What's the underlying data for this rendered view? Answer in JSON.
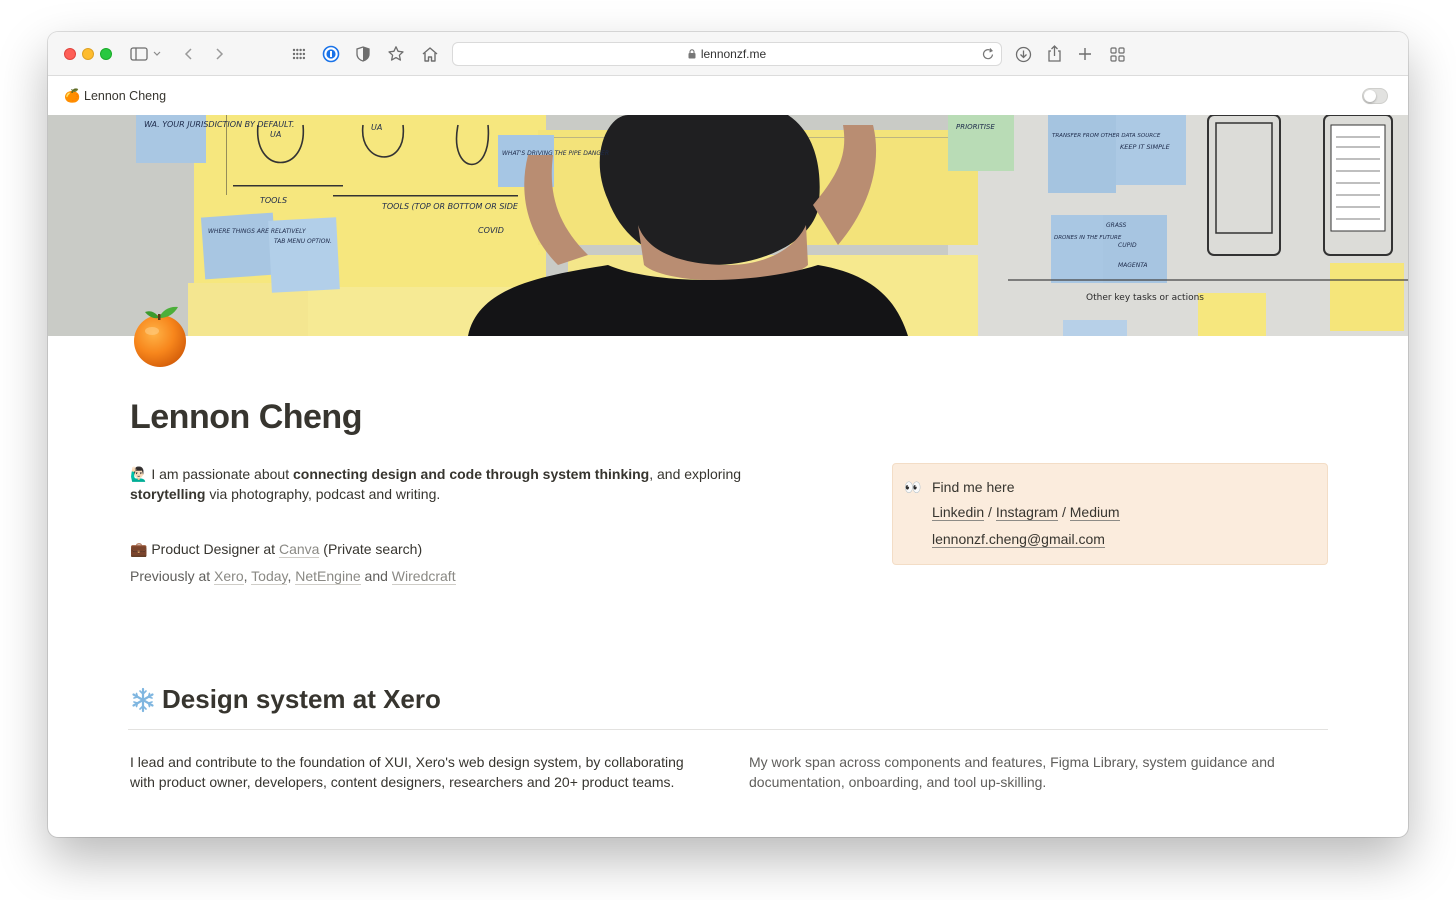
{
  "browser": {
    "url": "lennonzf.me"
  },
  "notion_bar": {
    "favicon": "🍊",
    "page_title": "Lennon Cheng"
  },
  "cover": {
    "sticky_notes": [
      "WA. YOUR JURISDICTION BY DEFAULT.",
      "UA",
      "UA",
      "TOOLS",
      "TOOLS (TOP OR BOTTOM OR SIDE",
      "COVID",
      "WHAT'S DRIVING THE PIPE DANGER",
      "WHERE THINGS ARE RELATIVELY",
      "TAB MENU OPTION.",
      "PRIORITISE",
      "TRANSFER FROM OTHER DATA SOURCE",
      "KEEP IT SIMPLE",
      "DRONES IN THE FUTURE",
      "GRASS",
      "CUPID",
      "MAGENTA",
      "Other key tasks or actions"
    ]
  },
  "page": {
    "icon": "🍊",
    "title": "Lennon Cheng",
    "intro": {
      "emoji": "🙋🏻‍♂️",
      "pre": " I am passionate about ",
      "bold1": "connecting design and code through system thinking",
      "mid": ", and exploring ",
      "bold2": "storytelling",
      "post": " via photography, podcast and writing."
    },
    "job": {
      "emoji": "💼",
      "pre": " Product Designer at ",
      "company": "Canva",
      "post": " (Private search)"
    },
    "previously": {
      "pre": "Previously at ",
      "companies": [
        "Xero",
        "Today",
        "NetEngine",
        "Wiredcraft"
      ],
      "sep": ", ",
      "and": " and "
    },
    "callout": {
      "icon": "👀",
      "title": "Find me here",
      "links": [
        "Linkedin",
        "Instagram",
        "Medium"
      ],
      "link_sep": " / ",
      "email": "lennonzf.cheng@gmail.com"
    },
    "section": {
      "icon": "snowflake",
      "title": "Design system at Xero",
      "left_text": "I lead and contribute to the foundation of XUI, Xero's web design system, by collaborating with product owner, developers, content designers, researchers and 20+ product teams.",
      "right_text": "My work span across components and features, Figma Library, system guidance and documentation, onboarding, and tool up-skilling."
    }
  },
  "colors": {
    "callout_bg": "#fbecdd",
    "text": "#37352f",
    "muted_text": "#5f5e5b",
    "link_gray": "#8a8984"
  }
}
